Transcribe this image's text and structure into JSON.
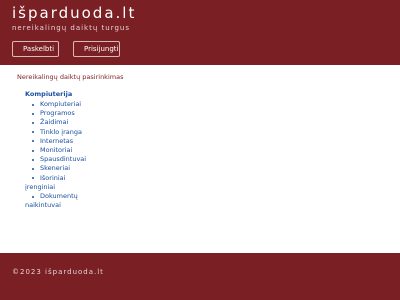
{
  "header": {
    "title": "išparduoda.lt",
    "tagline": "nereikalingų daiktų turgus",
    "buttons": [
      {
        "label": "Paskelbti",
        "icon": "megaphone-icon"
      },
      {
        "label": "Prisijungti",
        "icon": "login-icon"
      }
    ]
  },
  "main": {
    "subtitle": "Nereikalingų daiktų pasirinkimas",
    "category": {
      "title": "Kompiuterija",
      "items": [
        "Kompiuteriai",
        "Programos",
        "Žaidimai",
        "Tinklo įranga",
        "Internetas",
        "Monitoriai",
        "Spausdintuvai",
        "Skeneriai"
      ],
      "wrapped_items": [
        {
          "first": "Išoriniai",
          "second": "įrenginiai"
        },
        {
          "first": "Dokumentų",
          "second": "naikintuvai"
        }
      ]
    }
  },
  "footer": {
    "copyright": "©2023 išparduoda.lt"
  },
  "colors": {
    "brand": "#7a1f24",
    "link": "#1a4fa0"
  }
}
